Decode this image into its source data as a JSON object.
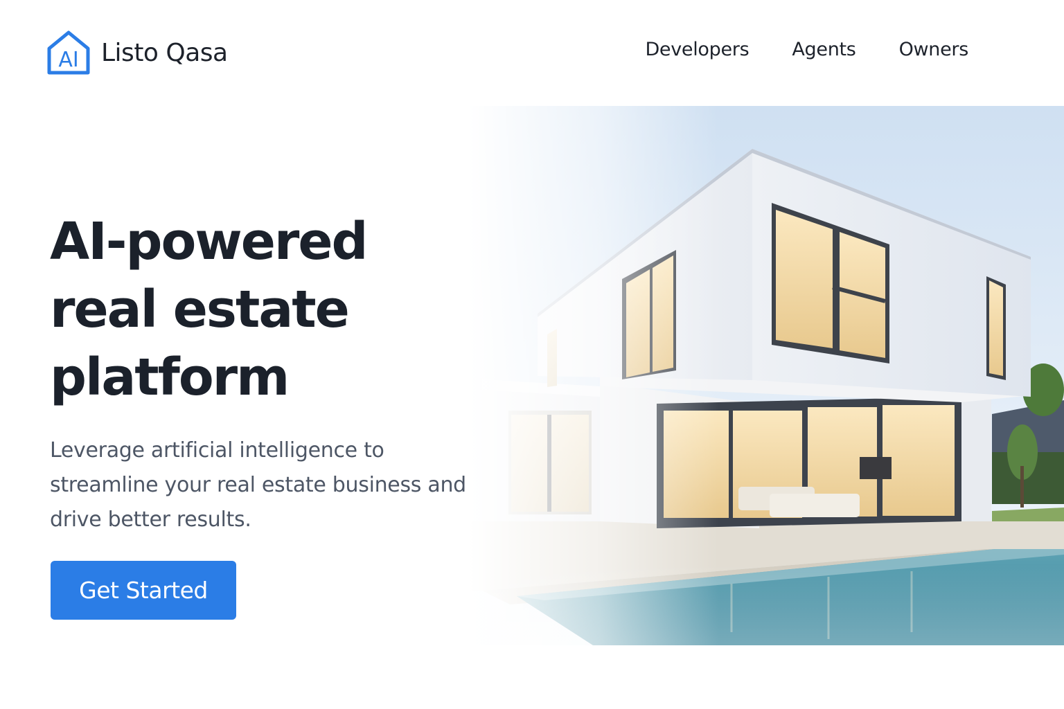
{
  "brand": {
    "logo_text": "AI",
    "name": "Listo Qasa",
    "icon": "house-ai-logo-icon"
  },
  "nav": {
    "items": [
      {
        "label": "Developers"
      },
      {
        "label": "Agents"
      },
      {
        "label": "Owners"
      }
    ]
  },
  "hero": {
    "headline_lines": [
      "AI-powered",
      "real estate",
      "platform"
    ],
    "subtitle": "Leverage artificial intelligence to streamline your real estate business and drive better results.",
    "cta_label": "Get Started",
    "image": "modern-house-with-pool-illustration"
  },
  "colors": {
    "accent": "#2b7de6",
    "heading": "#1b212b",
    "body_text": "#4d5665",
    "background": "#ffffff"
  }
}
